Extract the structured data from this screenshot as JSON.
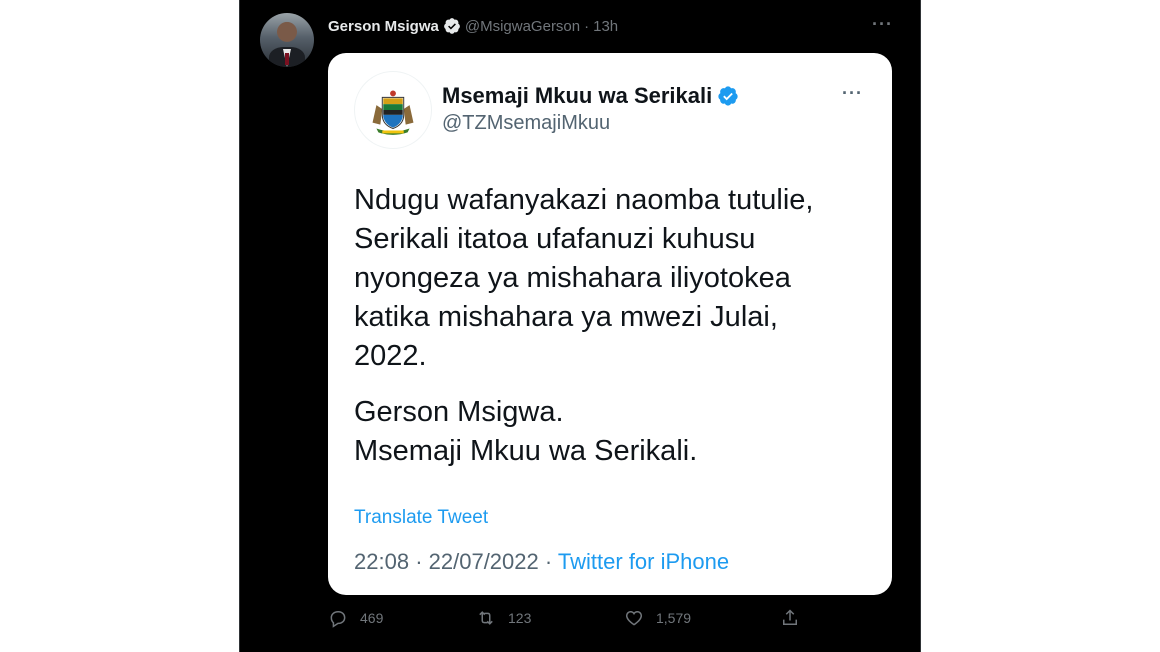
{
  "tweet": {
    "author_name": "Gerson Msigwa",
    "author_handle": "@MsigwaGerson",
    "separator": "·",
    "time_ago": "13h",
    "more_label": "···"
  },
  "embed": {
    "name": "Msemaji Mkuu wa Serikali",
    "handle": "@TZMsemajiMkuu",
    "more_label": "···",
    "text_lines": [
      "Ndugu wafanyakazi naomba tutulie,",
      "Serikali itatoa ufafanuzi kuhusu",
      "nyongeza ya mishahara iliyotokea",
      "katika mishahara ya mwezi Julai,",
      "2022.",
      "Gerson Msigwa.",
      "Msemaji Mkuu wa Serikali."
    ],
    "translate_label": "Translate Tweet",
    "time": "22:08",
    "date": "22/07/2022",
    "source": "Twitter for iPhone"
  },
  "actions": {
    "replies": "469",
    "retweets": "123",
    "likes": "1,579"
  },
  "colors": {
    "background": "#000000",
    "card": "#ffffff",
    "accent": "#1d9bf0",
    "muted": "#71767b"
  },
  "icons": [
    "verified-badge-icon",
    "more-icon",
    "reply-icon",
    "retweet-icon",
    "like-icon",
    "share-icon"
  ]
}
